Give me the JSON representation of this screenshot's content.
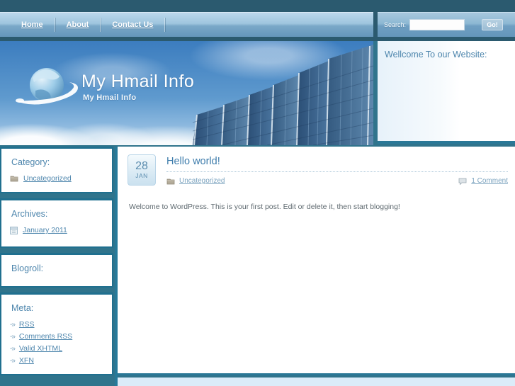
{
  "nav": {
    "items": [
      {
        "label": "Home"
      },
      {
        "label": "About"
      },
      {
        "label": "Contact Us"
      }
    ]
  },
  "search": {
    "label": "Search:",
    "value": "",
    "button_label": "Go!"
  },
  "header": {
    "title": "My Hmail Info",
    "subtitle": "My Hmail Info",
    "logo": "globe-swoosh-logo"
  },
  "welcome_panel": {
    "title": "Wellcome To our Website:"
  },
  "sidebar": {
    "sections": [
      {
        "title": "Category:",
        "links": [
          {
            "icon": "folder-icon",
            "label": "Uncategorized"
          }
        ]
      },
      {
        "title": "Archives:",
        "links": [
          {
            "icon": "calendar-icon",
            "label": "January 2011"
          }
        ]
      },
      {
        "title": "Blogroll:",
        "links": []
      },
      {
        "title": "Meta:",
        "links": [
          {
            "icon": "arrow-icon",
            "label": "RSS"
          },
          {
            "icon": "arrow-icon",
            "label": "Comments RSS"
          },
          {
            "icon": "arrow-icon",
            "label": "Valid XHTML"
          },
          {
            "icon": "arrow-icon",
            "label": "XFN"
          }
        ]
      }
    ]
  },
  "post": {
    "date_day": "28",
    "date_month": "JAN",
    "title": "Hello world!",
    "category": "Uncategorized",
    "comments_label": "1 Comment",
    "body": "Welcome to WordPress. This is your first post. Edit or delete it, then start blogging!"
  },
  "icons": {
    "meta_arrow": "-»"
  },
  "colors": {
    "page_background": "#30748c",
    "top_strip": "#2b5a6f",
    "accent_border": "#267a9a",
    "link_blue": "#4e86ad",
    "post_title_blue": "#3f7dac",
    "footer_blue": "#dbecf9"
  }
}
